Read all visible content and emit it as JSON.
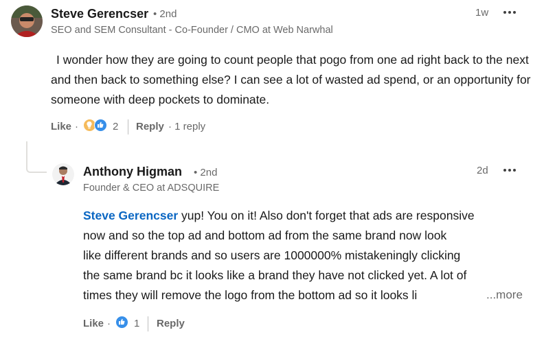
{
  "comment": {
    "author": "Steve Gerencser",
    "degree": "• 2nd",
    "headline": "SEO and SEM Consultant - Co-Founder / CMO at Web Narwhal",
    "time": "1w",
    "text": "I wonder how they are going to count people that pogo from one ad right back to the next and then back to something else? I can see a lot of wasted ad spend, or an opportunity for someone with deep pockets to dominate.",
    "like_label": "Like",
    "separator": "·",
    "reaction_count": "2",
    "reply_label": "Reply",
    "replies_label": "· 1 reply",
    "reactions": [
      "insightful-icon",
      "like-icon"
    ]
  },
  "reply": {
    "author": "Anthony Higman",
    "degree": "• 2nd",
    "headline": "Founder & CEO at ADSQUIRE",
    "time": "2d",
    "mention": "Steve Gerencser",
    "text_lines": [
      " yup! You on it! Also don't forget that ads are responsive",
      "now and so the top ad and bottom ad from the same brand now look",
      "like different brands and so users are 1000000% mistakeningly clicking",
      "the same brand bc it looks like a brand they have not clicked yet. A lot of",
      "times they will remove the logo from the bottom ad so it looks li"
    ],
    "more_label": "...more",
    "like_label": "Like",
    "separator": "·",
    "reaction_count": "1",
    "reply_label": "Reply",
    "reactions": [
      "like-icon"
    ]
  },
  "colors": {
    "link": "#0a66c2",
    "like_blue": "#378fe9",
    "insightful_yellow": "#f5bb5c",
    "thread_line": "#e0dfdc"
  }
}
